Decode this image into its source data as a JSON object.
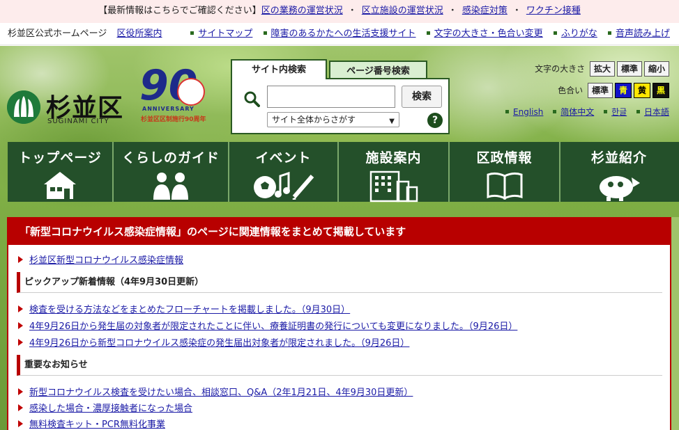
{
  "alert": {
    "prefix": "【最新情報はこちらでご確認ください】",
    "links": [
      "区の業務の運営状況",
      "区立施設の運営状況",
      "感染症対策",
      "ワクチン接種"
    ],
    "separator": "・"
  },
  "util": {
    "site_name": "杉並区公式ホームページ",
    "office_link": "区役所案内",
    "links": [
      "サイトマップ",
      "障害のあるかたへの生活支援サイト",
      "文字の大きさ・色合い変更",
      "ふりがな",
      "音声読み上げ"
    ]
  },
  "logo": {
    "name": "杉並区",
    "sub": "SUGINAMI CITY"
  },
  "anniversary": {
    "number": "90",
    "label": "ANNIVERSARY",
    "caption": "杉並区区制施行90周年"
  },
  "search": {
    "tab_site": "サイト内検索",
    "tab_page": "ページ番号検索",
    "input_value": "",
    "button": "検索",
    "scope": "サイト全体からさがす",
    "help": "?"
  },
  "text_size": {
    "label": "文字の大きさ",
    "buttons": [
      "拡大",
      "標準",
      "縮小"
    ]
  },
  "color": {
    "label": "色合い",
    "buttons": [
      "標準",
      "青",
      "黄",
      "黒"
    ]
  },
  "languages": [
    "English",
    "简体中文",
    "한글",
    "日本語"
  ],
  "gnav": [
    {
      "label": "トップページ",
      "icon": "house-icon"
    },
    {
      "label": "くらしのガイド",
      "icon": "people-icon"
    },
    {
      "label": "イベント",
      "icon": "event-icon"
    },
    {
      "label": "施設案内",
      "icon": "building-icon"
    },
    {
      "label": "区政情報",
      "icon": "book-icon"
    },
    {
      "label": "杉並紹介",
      "icon": "mascot-icon"
    }
  ],
  "covid": {
    "banner": "「新型コロナウイルス感染症情報」のページに関連情報をまとめて掲載しています",
    "top_link": "杉並区新型コロナウイルス感染症情報",
    "pickup_heading": "ピックアップ新着情報（4年9月30日更新）",
    "pickup_links": [
      "検査を受ける方法などをまとめたフローチャートを掲載しました。（9月30日）",
      "4年9月26日から発生届の対象者が限定されたことに伴い、療養証明書の発行についても変更になりました。（9月26日）",
      "4年9月26日から新型コロナウイルス感染症の発生届出対象者が限定されました。（9月26日）"
    ],
    "notice_heading": "重要なお知らせ",
    "notice_links": [
      "新型コロナウイルス検査を受けたい場合、相談窓口、Q&A（2年1月21日、4年9月30日更新）",
      "感染した場合・濃厚接触者になった場合",
      "無料検査キット・PCR無料化事業"
    ]
  }
}
